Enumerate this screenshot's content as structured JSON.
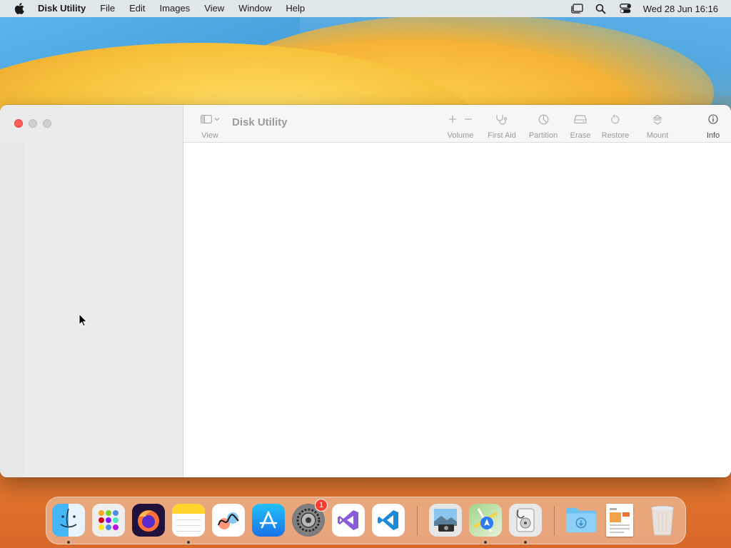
{
  "menubar": {
    "app_name": "Disk Utility",
    "items": [
      "File",
      "Edit",
      "Images",
      "View",
      "Window",
      "Help"
    ],
    "clock": "Wed 28 Jun  16:16"
  },
  "window": {
    "title": "Disk Utility",
    "toolbar": {
      "view_label": "View",
      "volume_label": "Volume",
      "first_aid_label": "First Aid",
      "partition_label": "Partition",
      "erase_label": "Erase",
      "restore_label": "Restore",
      "mount_label": "Mount",
      "info_label": "Info"
    }
  },
  "dock": {
    "apps": [
      {
        "name": "finder-icon"
      },
      {
        "name": "launchpad-icon"
      },
      {
        "name": "firefox-icon"
      },
      {
        "name": "notes-icon"
      },
      {
        "name": "freeform-icon"
      },
      {
        "name": "app-store-icon"
      },
      {
        "name": "system-settings-icon",
        "badge": "1"
      },
      {
        "name": "visual-studio-icon"
      },
      {
        "name": "vscode-icon"
      },
      {
        "name": "preview-icon"
      },
      {
        "name": "maps-icon"
      },
      {
        "name": "disk-utility-icon"
      },
      {
        "name": "downloads-folder-icon"
      },
      {
        "name": "document-icon"
      },
      {
        "name": "trash-icon"
      }
    ]
  },
  "colors": {
    "close": "#fe5f57",
    "sidebar_bg": "#ebebeb",
    "toolbar_bg": "#f6f6f6",
    "badge": "#ff3b30"
  }
}
